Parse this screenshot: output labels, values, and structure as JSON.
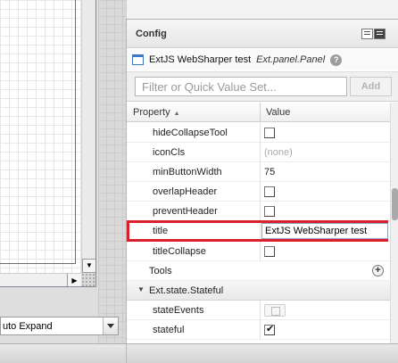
{
  "config_panel": {
    "title": "Config",
    "component": {
      "name": "ExtJS WebSharper test",
      "type": "Ext.panel.Panel",
      "help_glyph": "?"
    },
    "filter": {
      "placeholder": "Filter or Quick Value Set...",
      "add_label": "Add"
    },
    "columns": {
      "property": "Property",
      "value": "Value"
    },
    "rows": [
      {
        "name": "hideCollapseTool",
        "value_type": "checkbox",
        "checked": false
      },
      {
        "name": "iconCls",
        "value_type": "text",
        "value": "(none)"
      },
      {
        "name": "minButtonWidth",
        "value_type": "text",
        "value": "75"
      },
      {
        "name": "overlapHeader",
        "value_type": "checkbox",
        "checked": false
      },
      {
        "name": "preventHeader",
        "value_type": "checkbox",
        "checked": false
      },
      {
        "name": "title",
        "value_type": "editing",
        "value": "ExtJS WebSharper test",
        "highlighted": true
      },
      {
        "name": "titleCollapse",
        "value_type": "checkbox",
        "checked": false
      },
      {
        "name": "Tools",
        "value_type": "add"
      },
      {
        "name": "Ext.state.Stateful",
        "value_type": "section"
      },
      {
        "name": "stateEvents",
        "value_type": "events"
      },
      {
        "name": "stateful",
        "value_type": "checkbox",
        "checked": true
      }
    ]
  },
  "layout_select": {
    "value": "uto Expand"
  },
  "icons": {
    "component": "panel-icon",
    "help": "help-icon",
    "add": "plus-circle-icon",
    "sort": "sort-asc-icon",
    "expand": "caret-down-icon"
  },
  "colors": {
    "highlight": "#d9202e",
    "panel_accent": "#3a78c2"
  }
}
